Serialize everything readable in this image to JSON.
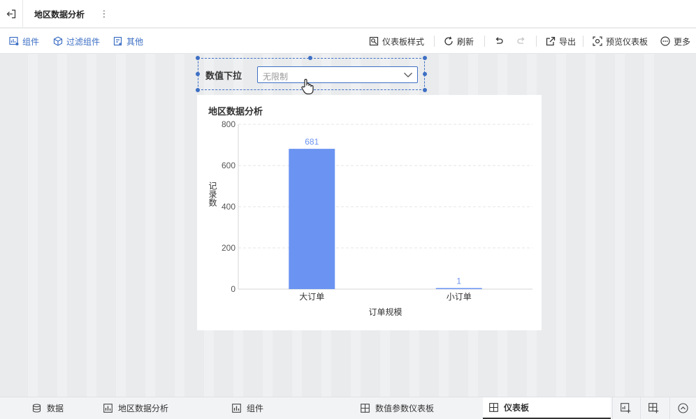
{
  "header": {
    "active_tab": "地区数据分析",
    "more_glyph": "⋮"
  },
  "toolbar": {
    "component": "组件",
    "filter_component": "过滤组件",
    "other": "其他",
    "dashboard_style": "仪表板样式",
    "refresh": "刷新",
    "export": "导出",
    "preview": "预览仪表板",
    "more": "更多"
  },
  "filter": {
    "label": "数值下拉",
    "placeholder": "无限制"
  },
  "chart_data": {
    "type": "bar",
    "title": "地区数据分析",
    "categories": [
      "大订单",
      "小订单"
    ],
    "values": [
      681,
      1
    ],
    "xlabel": "订单规模",
    "ylabel": "记录数",
    "ylim": [
      0,
      800
    ],
    "yticks": [
      0,
      200,
      400,
      600,
      800
    ],
    "color": "#6b93f1",
    "grid": true
  },
  "bottom": {
    "tabs": [
      "数据",
      "地区数据分析",
      "组件",
      "数值参数仪表板",
      "仪表板"
    ],
    "active_index": 4
  },
  "colors": {
    "accent": "#3d6fc4",
    "bar": "#6b93f1"
  }
}
